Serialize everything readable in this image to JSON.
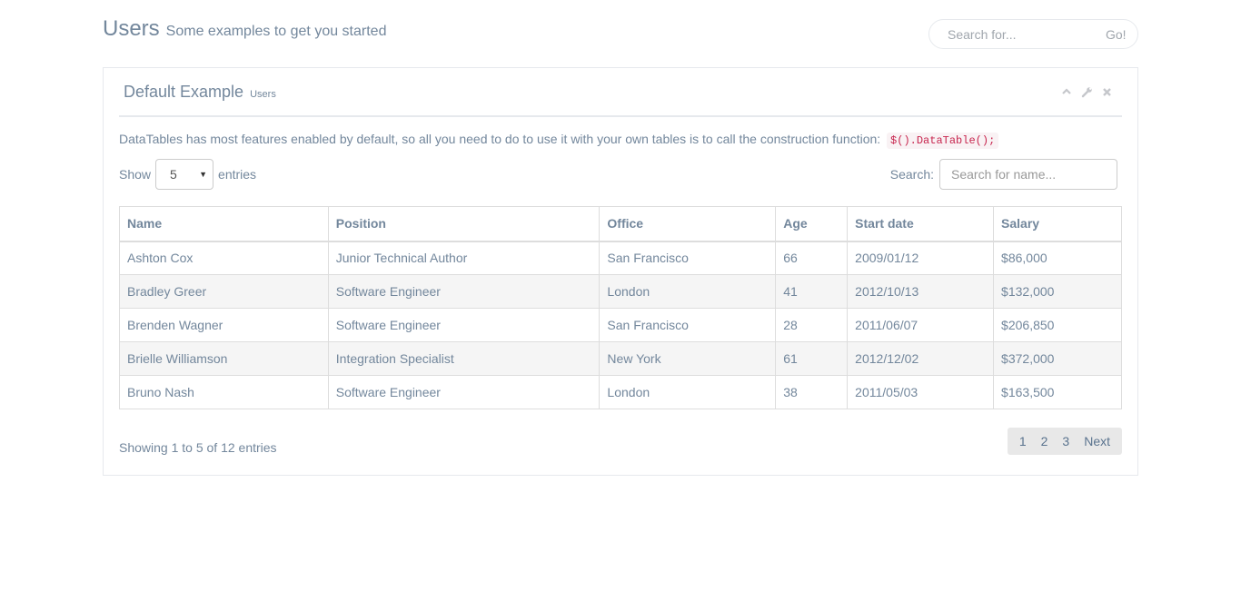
{
  "header": {
    "title": "Users",
    "subtitle": "Some examples to get you started",
    "search_placeholder": "Search for...",
    "search_go": "Go!"
  },
  "panel": {
    "title": "Default Example",
    "title_small": "Users",
    "tools": [
      "chevron-up-icon",
      "wrench-icon",
      "close-icon"
    ],
    "intro_text": "DataTables has most features enabled by default, so all you need to do to use it with your own tables is to call the construction function:",
    "intro_code": "$().DataTable();"
  },
  "table_controls": {
    "show_label": "Show",
    "entries_value": "5",
    "entries_label": "entries",
    "search_label": "Search:",
    "search_placeholder": "Search for name..."
  },
  "table": {
    "headers": [
      "Name",
      "Position",
      "Office",
      "Age",
      "Start date",
      "Salary"
    ],
    "rows": [
      [
        "Ashton Cox",
        "Junior Technical Author",
        "San Francisco",
        "66",
        "2009/01/12",
        "$86,000"
      ],
      [
        "Bradley Greer",
        "Software Engineer",
        "London",
        "41",
        "2012/10/13",
        "$132,000"
      ],
      [
        "Brenden Wagner",
        "Software Engineer",
        "San Francisco",
        "28",
        "2011/06/07",
        "$206,850"
      ],
      [
        "Brielle Williamson",
        "Integration Specialist",
        "New York",
        "61",
        "2012/12/02",
        "$372,000"
      ],
      [
        "Bruno Nash",
        "Software Engineer",
        "London",
        "38",
        "2011/05/03",
        "$163,500"
      ]
    ]
  },
  "footer": {
    "info": "Showing 1 to 5 of 12 entries",
    "pages": [
      "1",
      "2",
      "3"
    ],
    "next": "Next"
  }
}
